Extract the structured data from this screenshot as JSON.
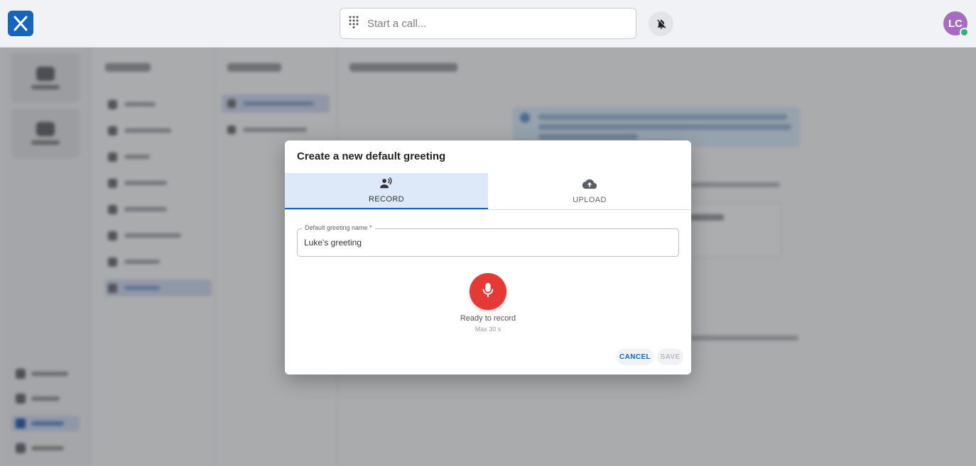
{
  "topbar": {
    "search_placeholder": "Start a call...",
    "avatar_initials": "LC"
  },
  "dialog": {
    "title": "Create a new default greeting",
    "tabs": [
      {
        "label": "RECORD",
        "icon": "record-voice-icon",
        "active": true
      },
      {
        "label": "UPLOAD",
        "icon": "cloud-upload-icon",
        "active": false
      }
    ],
    "field_label": "Default greeting name *",
    "field_value": "Luke's greeting",
    "status_main": "Ready to record",
    "status_sub": "Max 30 s",
    "cancel_label": "CANCEL",
    "save_label": "SAVE"
  },
  "colors": {
    "brand": "#1565c0",
    "record": "#e53935",
    "active_tab_bg": "#dde8f8",
    "avatar_bg": "#a56cc1",
    "presence": "#2bb673"
  }
}
